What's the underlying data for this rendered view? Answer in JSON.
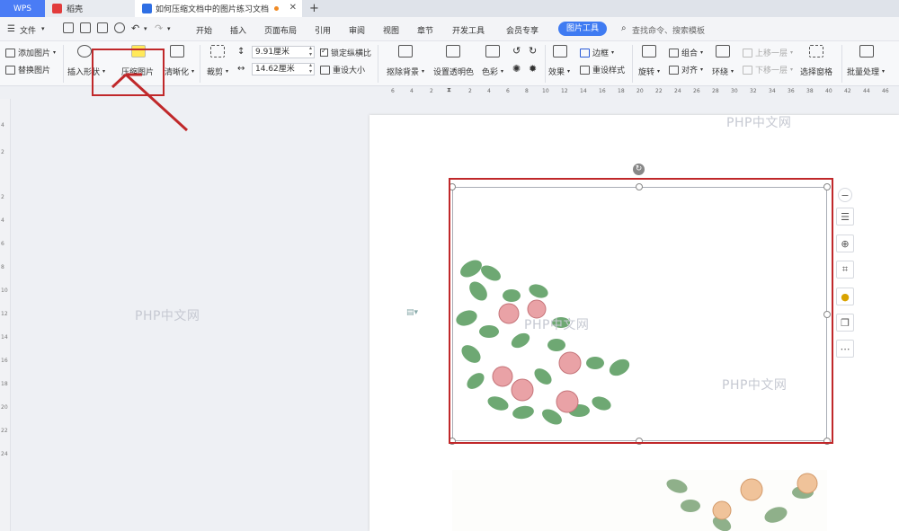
{
  "tabs": {
    "wps": "WPS",
    "shell": "稻壳",
    "doc": "如何压缩文档中的图片练习文档",
    "new": "+"
  },
  "menu": {
    "file": "文件",
    "items": [
      "开始",
      "插入",
      "页面布局",
      "引用",
      "审阅",
      "视图",
      "章节",
      "开发工具",
      "会员专享"
    ],
    "active": "图片工具",
    "search": "查找命令、搜索模板"
  },
  "ribbon": {
    "add_image": "添加图片",
    "replace_image": "替换图片",
    "insert_shape": "插入形状",
    "compress_image": "压缩图片",
    "sharpen": "清晰化",
    "crop": "裁剪",
    "height": "9.91厘米",
    "width": "14.62厘米",
    "lock_ratio": "锁定纵横比",
    "reset_size": "重设大小",
    "remove_bg": "抠除背景",
    "set_transparent": "设置透明色",
    "color": "色彩",
    "effects": "效果",
    "border": "边框",
    "reset_style": "重设样式",
    "rotate": "旋转",
    "group": "组合",
    "align": "对齐",
    "wrap": "环绕",
    "bring_forward": "上移一层",
    "send_backward": "下移一层",
    "selection_pane": "选择窗格",
    "batch_process": "批量处理"
  },
  "ruler": {
    "h": [
      "6",
      "4",
      "2",
      "2",
      "4",
      "6",
      "8",
      "10",
      "12",
      "14",
      "16",
      "18",
      "20",
      "22",
      "24",
      "26",
      "28",
      "30",
      "32",
      "34",
      "36",
      "38",
      "40",
      "42",
      "44",
      "46"
    ],
    "v": [
      "4",
      "2",
      "2",
      "4",
      "6",
      "8",
      "10",
      "12",
      "14",
      "16",
      "18",
      "20",
      "22",
      "24"
    ]
  },
  "watermark": "PHP中文网",
  "colors": {
    "accent": "#3f7bf2",
    "highlight": "#c0282a"
  }
}
